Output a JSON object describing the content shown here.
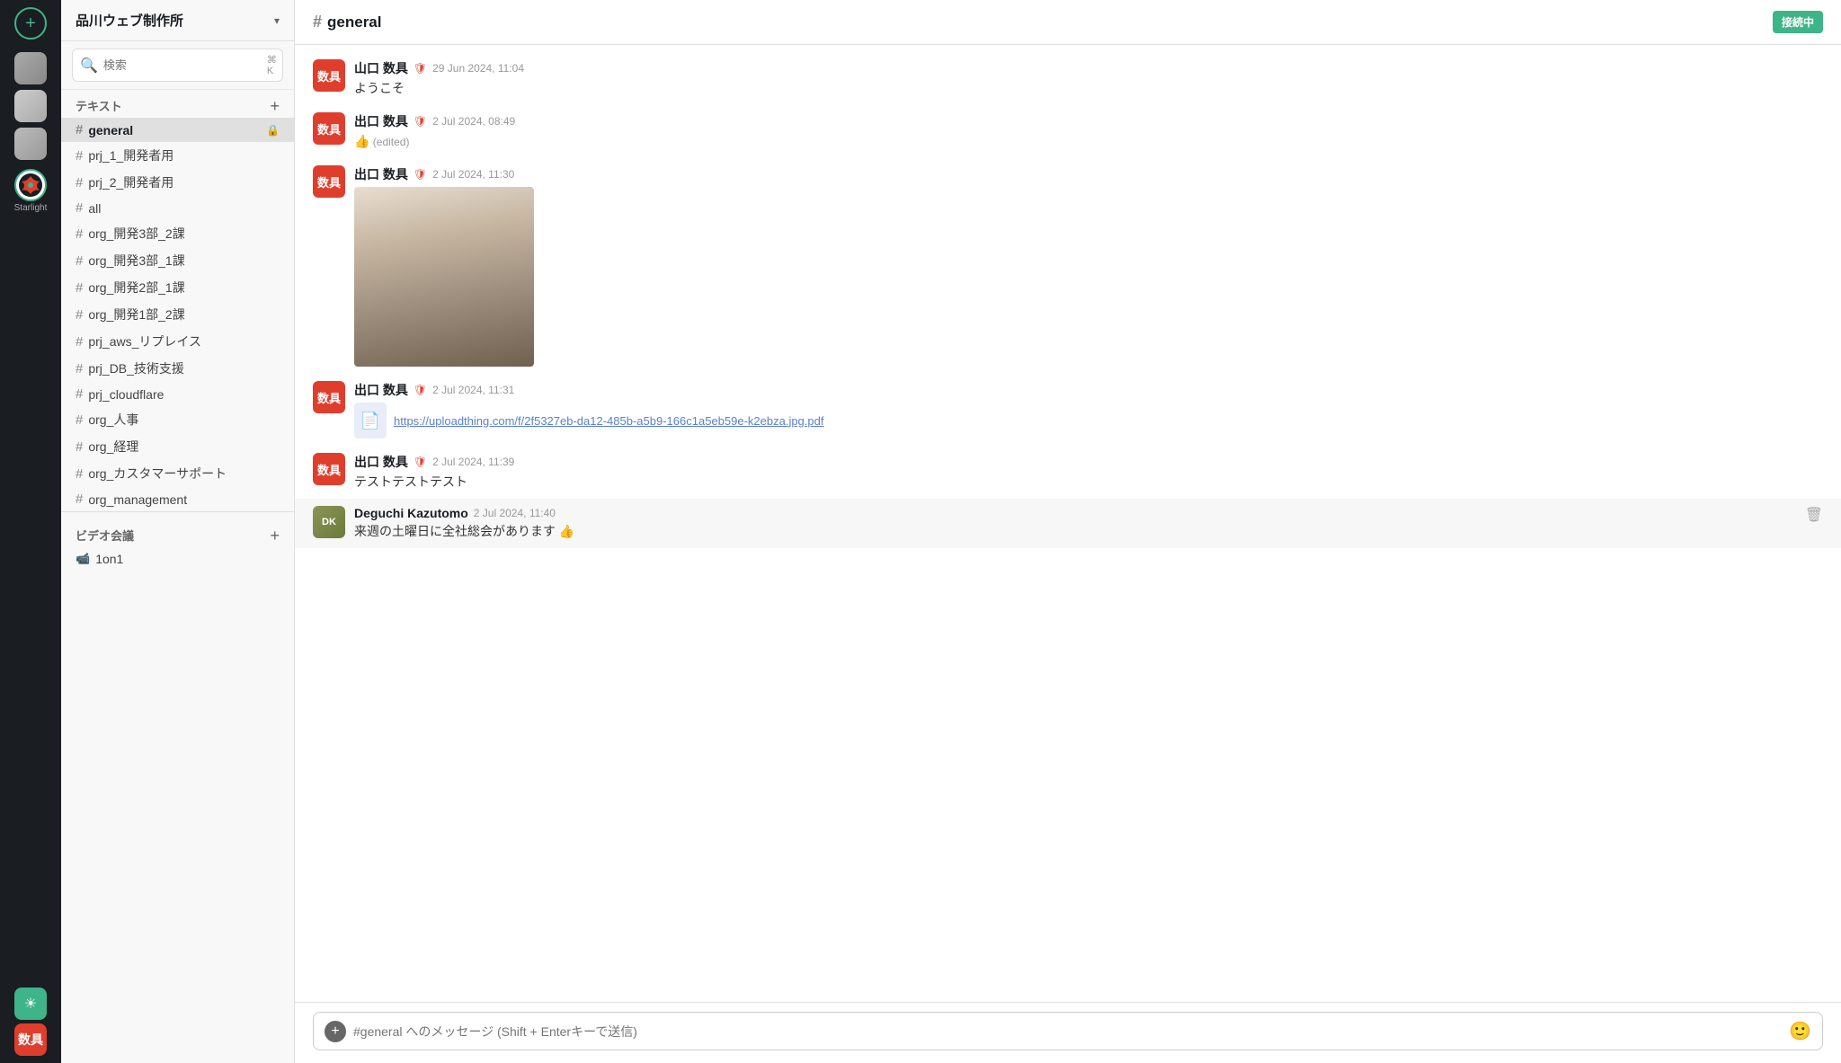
{
  "app": {
    "workspace_name": "品川ウェブ制作所",
    "connected_label": "接続中",
    "channel_active": "general"
  },
  "sidebar": {
    "search_placeholder": "検索",
    "search_shortcut": "⌘ K",
    "text_section_label": "テキスト",
    "video_section_label": "ビデオ会議",
    "channels": [
      {
        "name": "general",
        "active": true,
        "locked": true
      },
      {
        "name": "prj_1_開発者用",
        "active": false
      },
      {
        "name": "prj_2_開発者用",
        "active": false
      },
      {
        "name": "all",
        "active": false
      },
      {
        "name": "org_開発3部_2課",
        "active": false
      },
      {
        "name": "org_開発3部_1課",
        "active": false
      },
      {
        "name": "org_開発2部_1課",
        "active": false
      },
      {
        "name": "org_開発1部_2課",
        "active": false
      },
      {
        "name": "prj_aws_リプレイス",
        "active": false
      },
      {
        "name": "prj_DB_技術支援",
        "active": false
      },
      {
        "name": "prj_cloudflare",
        "active": false
      },
      {
        "name": "org_人事",
        "active": false
      },
      {
        "name": "org_経理",
        "active": false
      },
      {
        "name": "org_カスタマーサポート",
        "active": false
      },
      {
        "name": "org_management",
        "active": false
      }
    ],
    "video_channels": [
      {
        "name": "1on1"
      }
    ]
  },
  "chat": {
    "channel_name": "general",
    "input_placeholder": "#general へのメッセージ (Shift + Enterキーで送信)",
    "messages": [
      {
        "id": "msg1",
        "author": "山口 数具",
        "avatar_text": "数具",
        "shield": true,
        "time": "29 Jun 2024, 11:04",
        "text": "ようこそ",
        "reaction": null
      },
      {
        "id": "msg2",
        "author": "出口 数具",
        "avatar_text": "数具",
        "shield": true,
        "time": "2 Jul 2024, 08:49",
        "text": "👍",
        "edited": true,
        "edited_label": "(edited)"
      },
      {
        "id": "msg3",
        "author": "出口 数具",
        "avatar_text": "数具",
        "shield": true,
        "time": "2 Jul 2024, 11:30",
        "text": "",
        "has_image": true
      },
      {
        "id": "msg4",
        "author": "出口 数具",
        "avatar_text": "数具",
        "shield": true,
        "time": "2 Jul 2024, 11:31",
        "text": "",
        "has_file": true,
        "file_url": "https://uploadthing.com/f/2f5327eb-da12-485b-a5b9-166c1a5eb59e-k2ebza.jpg.pdf"
      },
      {
        "id": "msg5",
        "author": "出口 数具",
        "avatar_text": "数具",
        "shield": true,
        "time": "2 Jul 2024, 11:39",
        "text": "テストテストテスト"
      },
      {
        "id": "msg6",
        "author": "Deguchi Kazutomo",
        "avatar_text": "DK",
        "avatar_type": "deguchi",
        "shield": false,
        "time": "2 Jul 2024, 11:40",
        "text": "来週の土曜日に全社総会があります 👍",
        "highlighted": true
      }
    ]
  },
  "icons": {
    "plus": "+",
    "hash": "#",
    "lock": "🔒",
    "shield": "🛡",
    "search": "🔍",
    "chevron_down": "▾",
    "file": "📄",
    "emoji": "🙂",
    "delete": "🗑",
    "sun": "☀",
    "video": "📹"
  },
  "starlight_label": "Starlight"
}
